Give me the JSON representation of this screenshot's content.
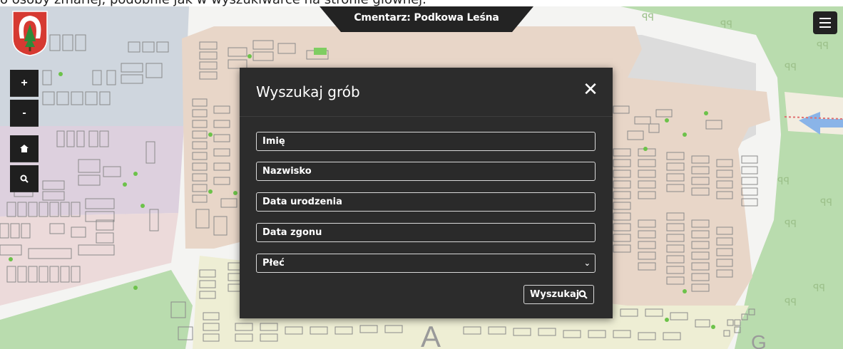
{
  "top_strip": {
    "text": "o osoby zmarłej, podobnie jak w wyszukiwarce na stronie głównej."
  },
  "header": {
    "title": "Cmentarz: Podkowa Leśna"
  },
  "map_controls": {
    "zoom_in": "+",
    "zoom_out": "-"
  },
  "map_labels": {
    "section_a": "A",
    "section_g": "G"
  },
  "modal": {
    "title": "Wyszukaj grób",
    "close": "✕",
    "fields": {
      "first_name": "Imię",
      "last_name": "Nazwisko",
      "birth_date": "Data urodzenia",
      "death_date": "Data zgonu",
      "gender": "Płeć"
    },
    "search_label": "Wyszukaj"
  },
  "icons": [
    "hamburger-menu-icon",
    "home-icon",
    "search-icon",
    "chevron-down-icon",
    "close-icon",
    "coat-of-arms-icon"
  ],
  "colors": {
    "dark": "#2c2c2c",
    "zone_blue": "#cfd6de",
    "zone_purple": "#ddd0de",
    "zone_pink": "#ecdada",
    "zone_tan": "#e8d6c8",
    "zone_green": "#b9dcae",
    "zone_yellow": "#eeeed4"
  }
}
